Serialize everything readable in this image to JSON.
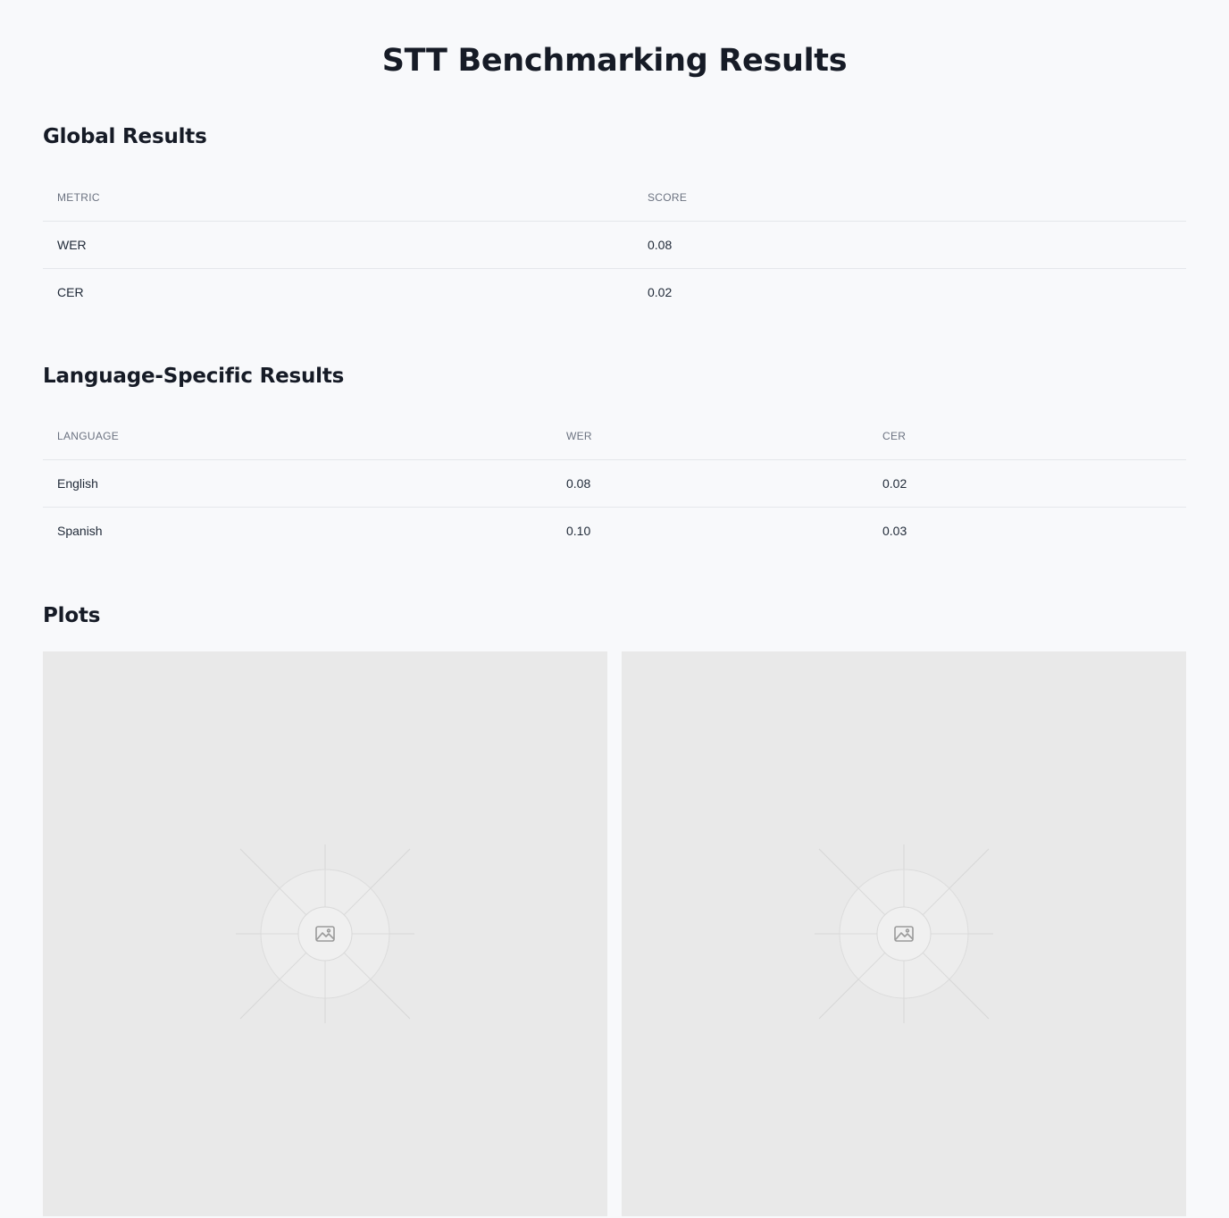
{
  "page": {
    "title": "STT Benchmarking Results"
  },
  "global": {
    "title": "Global Results",
    "columns": [
      "Metric",
      "Score"
    ],
    "rows": [
      {
        "metric": "WER",
        "score": "0.08"
      },
      {
        "metric": "CER",
        "score": "0.02"
      }
    ]
  },
  "language": {
    "title": "Language-Specific Results",
    "columns": [
      "Language",
      "WER",
      "CER"
    ],
    "rows": [
      {
        "language": "English",
        "wer": "0.08",
        "cer": "0.02"
      },
      {
        "language": "Spanish",
        "wer": "0.10",
        "cer": "0.03"
      }
    ]
  },
  "plots": {
    "title": "Plots",
    "items": [
      {
        "icon": "image-placeholder-icon"
      },
      {
        "icon": "image-placeholder-icon"
      }
    ]
  },
  "colors": {
    "background": "#f8f9fb",
    "heading": "#161b26",
    "muted": "#6b7280",
    "border": "#e5e7eb",
    "plot_bg": "#e9e9e9"
  }
}
